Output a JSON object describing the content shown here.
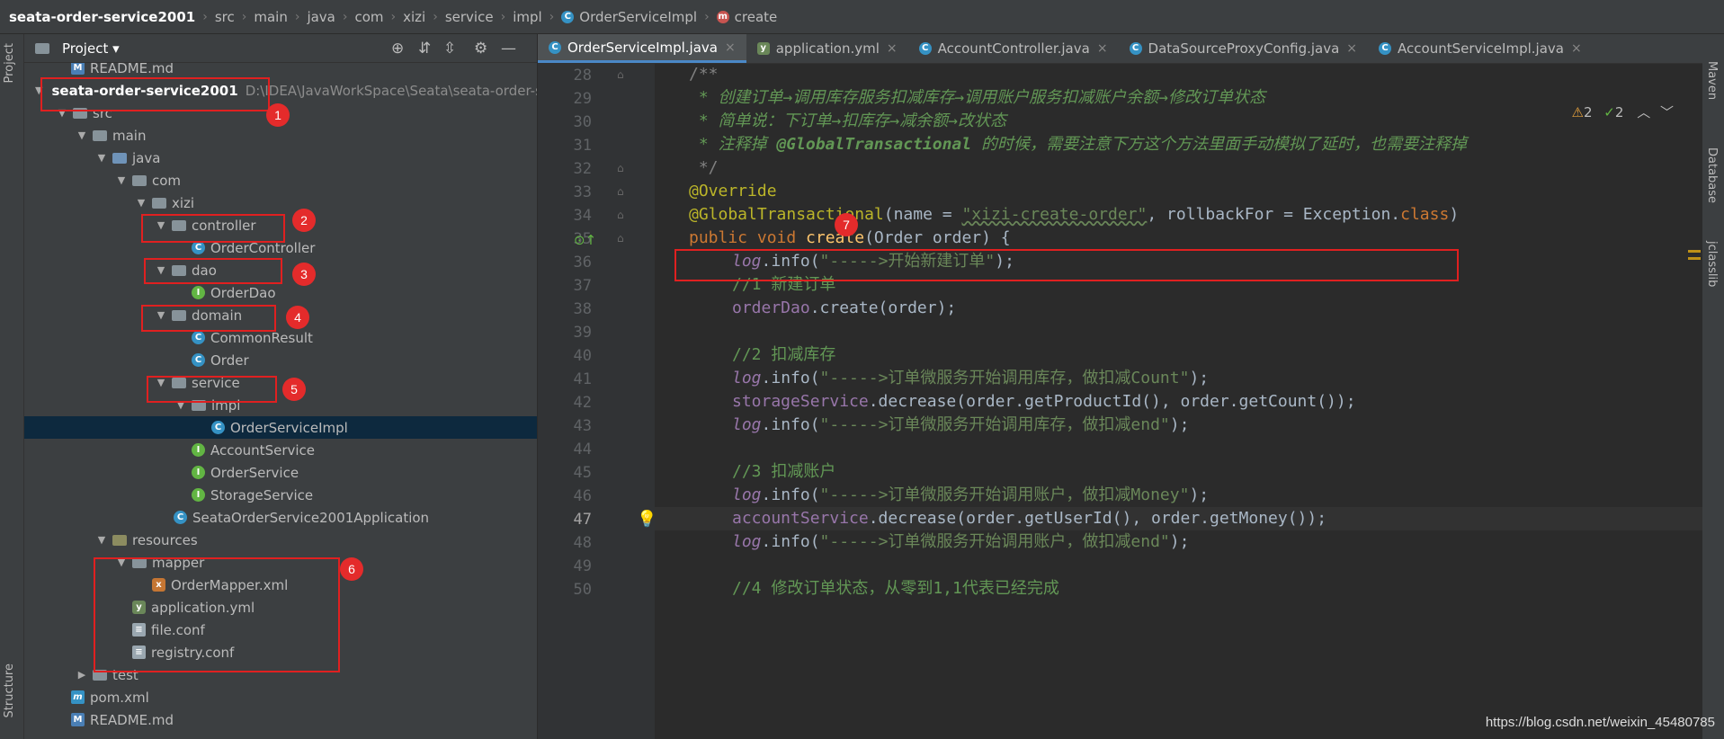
{
  "breadcrumb": {
    "items": [
      "seata-order-service2001",
      "src",
      "main",
      "java",
      "com",
      "xizi",
      "service",
      "impl",
      "OrderServiceImpl",
      "create"
    ]
  },
  "left_strip": {
    "project_tab": "Project",
    "structure_tab": "Structure"
  },
  "right_strip": {
    "maven_tab": "Maven",
    "database_tab": "Database",
    "jclasslib_tab": "jclasslib"
  },
  "project_panel": {
    "title": "Project",
    "tree": [
      {
        "label": "README.md",
        "icon": "md"
      },
      {
        "label": "seata-order-service2001",
        "path": "D:\\IDEA\\JavaWorkSpace\\Seata\\seata-order-se",
        "icon": "module"
      },
      {
        "label": "src",
        "icon": "folder"
      },
      {
        "label": "main",
        "icon": "folder"
      },
      {
        "label": "java",
        "icon": "source-folder"
      },
      {
        "label": "com",
        "icon": "package"
      },
      {
        "label": "xizi",
        "icon": "package"
      },
      {
        "label": "controller",
        "icon": "package"
      },
      {
        "label": "OrderController",
        "icon": "class"
      },
      {
        "label": "dao",
        "icon": "package"
      },
      {
        "label": "OrderDao",
        "icon": "interface"
      },
      {
        "label": "domain",
        "icon": "package"
      },
      {
        "label": "CommonResult",
        "icon": "class"
      },
      {
        "label": "Order",
        "icon": "class"
      },
      {
        "label": "service",
        "icon": "package"
      },
      {
        "label": "impl",
        "icon": "package"
      },
      {
        "label": "OrderServiceImpl",
        "icon": "class"
      },
      {
        "label": "AccountService",
        "icon": "interface"
      },
      {
        "label": "OrderService",
        "icon": "interface"
      },
      {
        "label": "StorageService",
        "icon": "interface"
      },
      {
        "label": "SeataOrderService2001Application",
        "icon": "spring-class"
      },
      {
        "label": "resources",
        "icon": "resources-folder"
      },
      {
        "label": "mapper",
        "icon": "folder"
      },
      {
        "label": "OrderMapper.xml",
        "icon": "xml"
      },
      {
        "label": "application.yml",
        "icon": "yml"
      },
      {
        "label": "file.conf",
        "icon": "conf"
      },
      {
        "label": "registry.conf",
        "icon": "conf"
      },
      {
        "label": "test",
        "icon": "folder"
      },
      {
        "label": "pom.xml",
        "icon": "maven"
      },
      {
        "label": "README.md",
        "icon": "md"
      }
    ]
  },
  "annotations": [
    "1",
    "2",
    "3",
    "4",
    "5",
    "6",
    "7"
  ],
  "editor": {
    "tabs": [
      {
        "label": "OrderServiceImpl.java",
        "icon": "class",
        "active": true
      },
      {
        "label": "application.yml",
        "icon": "yml"
      },
      {
        "label": "AccountController.java",
        "icon": "class"
      },
      {
        "label": "DataSourceProxyConfig.java",
        "icon": "class"
      },
      {
        "label": "AccountServiceImpl.java",
        "icon": "class"
      }
    ],
    "inspection": {
      "warnings": "2",
      "checks": "2"
    },
    "lines": [
      {
        "n": "28"
      },
      {
        "n": "29"
      },
      {
        "n": "30"
      },
      {
        "n": "31"
      },
      {
        "n": "32"
      },
      {
        "n": "33"
      },
      {
        "n": "34"
      },
      {
        "n": "35"
      },
      {
        "n": "36"
      },
      {
        "n": "37"
      },
      {
        "n": "38"
      },
      {
        "n": "39"
      },
      {
        "n": "40"
      },
      {
        "n": "41"
      },
      {
        "n": "42"
      },
      {
        "n": "43"
      },
      {
        "n": "44"
      },
      {
        "n": "45"
      },
      {
        "n": "46"
      },
      {
        "n": "47"
      },
      {
        "n": "48"
      },
      {
        "n": "49"
      },
      {
        "n": "50"
      }
    ],
    "code": {
      "l28": "/**",
      "l29": " * 创建订单→调用库存服务扣减库存→调用账户服务扣减账户余额→修改订单状态",
      "l30": " * 简单说：下订单→扣库存→减余额→改状态",
      "l31a": " * 注释掉 ",
      "l31b": "@GlobalTransactional",
      "l31c": " 的时候，需要注意下方这个方法里面手动模拟了延时，也需要注释掉",
      "l32": " */",
      "l33": "@Override",
      "l34a": "@GlobalTransactional",
      "l34b": "(name = ",
      "l34c": "\"xizi-create-order\"",
      "l34d": ", rollbackFor = Exception.",
      "l34e": "class",
      "l34f": ")",
      "l35a": "public void ",
      "l35b": "create",
      "l35c": "(Order order) {",
      "l36a": "log",
      "l36b": ".info(",
      "l36c": "\"----->开始新建订单\"",
      "l36d": ");",
      "l37": "//1 新建订单",
      "l38a": "orderDao",
      "l38b": ".create(order);",
      "l40": "//2 扣减库存",
      "l41a": "log",
      "l41b": ".info(",
      "l41c": "\"----->订单微服务开始调用库存，做扣减Count\"",
      "l41d": ");",
      "l42a": "storageService",
      "l42b": ".decrease(order.getProductId(), order.getCount());",
      "l43a": "log",
      "l43b": ".info(",
      "l43c": "\"----->订单微服务开始调用库存，做扣减end\"",
      "l43d": ");",
      "l45": "//3 扣减账户",
      "l46a": "log",
      "l46b": ".info(",
      "l46c": "\"----->订单微服务开始调用账户，做扣减Money\"",
      "l46d": ");",
      "l47a": "accountService",
      "l47b": ".decrease(order.getUserId(), order.getMoney());",
      "l48a": "log",
      "l48b": ".info(",
      "l48c": "\"----->订单微服务开始调用账户，做扣减end\"",
      "l48d": ");",
      "l50": "//4 修改订单状态，从零到1,1代表已经完成"
    }
  },
  "watermark": "https://blog.csdn.net/weixin_45480785",
  "colors": {
    "annotation_red": "#e02020",
    "badge_red": "#e42b2b",
    "active_tab_underline": "#4a88c7"
  }
}
